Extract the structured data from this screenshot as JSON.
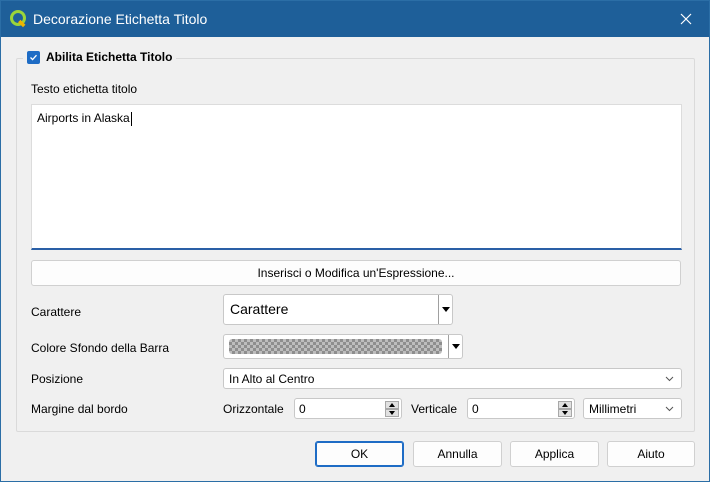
{
  "window": {
    "title": "Decorazione Etichetta Titolo",
    "accent_color": "#1e5f99"
  },
  "group": {
    "enable_label": "Abilita Etichetta Titolo",
    "enabled": true
  },
  "text": {
    "label": "Testo etichetta titolo",
    "value": "Airports in Alaska"
  },
  "expression_button": "Inserisci o Modifica un'Espressione...",
  "font": {
    "label": "Carattere",
    "button_text": "Carattere"
  },
  "bar_bg": {
    "label": "Colore Sfondo della Barra"
  },
  "position": {
    "label": "Posizione",
    "value": "In Alto al Centro"
  },
  "margin": {
    "label": "Margine dal bordo",
    "horizontal_label": "Orizzontale",
    "horizontal_value": "0",
    "vertical_label": "Verticale",
    "vertical_value": "0",
    "unit": "Millimetri"
  },
  "buttons": {
    "ok": "OK",
    "cancel": "Annulla",
    "apply": "Applica",
    "help": "Aiuto"
  }
}
